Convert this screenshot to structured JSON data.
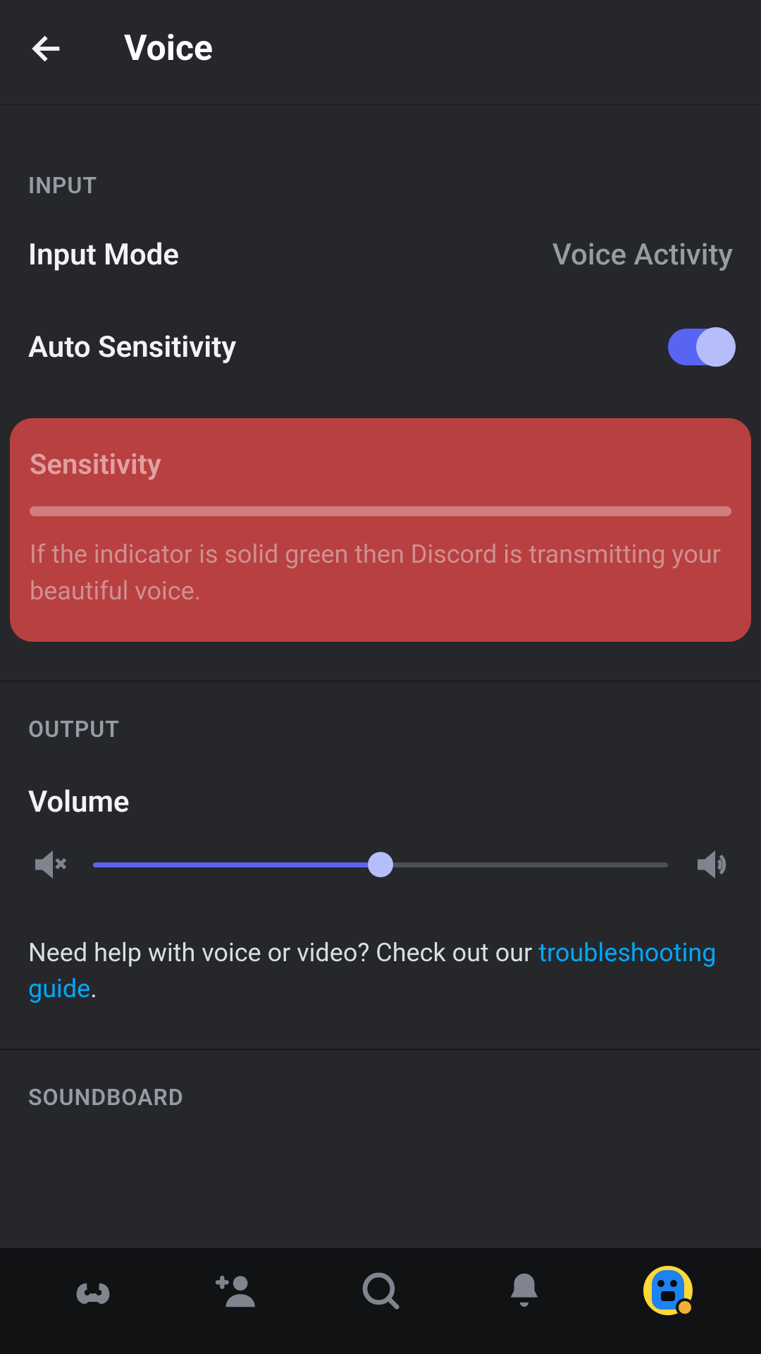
{
  "header": {
    "title": "Voice"
  },
  "sections": {
    "input": {
      "header": "INPUT",
      "input_mode": {
        "label": "Input Mode",
        "value": "Voice Activity"
      },
      "auto_sensitivity": {
        "label": "Auto Sensitivity",
        "enabled": true
      },
      "sensitivity": {
        "title": "Sensitivity",
        "description": "If the indicator is solid green then Discord is transmitting your beautiful voice."
      }
    },
    "output": {
      "header": "OUTPUT",
      "volume": {
        "label": "Volume",
        "value_percent": 50
      },
      "help": {
        "prefix": "Need help with voice or video? Check out our ",
        "link": "troubleshooting guide",
        "suffix": "."
      }
    },
    "soundboard": {
      "header": "SOUNDBOARD"
    }
  },
  "nav": {
    "home": "discord-icon",
    "friends": "friends-icon",
    "search": "search-icon",
    "notifications": "bell-icon",
    "profile": "avatar"
  }
}
